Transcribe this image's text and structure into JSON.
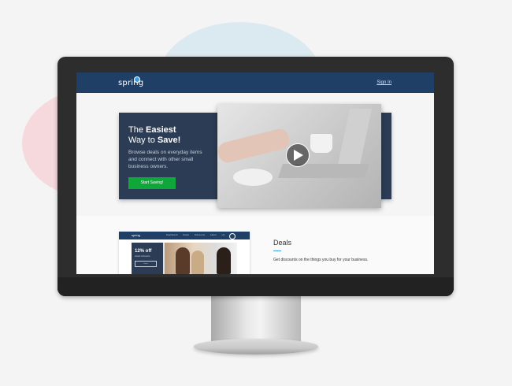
{
  "site": {
    "logo_text": "spring",
    "header_link": "Sign In"
  },
  "hero": {
    "title_prefix": "The ",
    "title_bold_1": "Easiest",
    "title_line2_prefix": "Way to ",
    "title_bold_2": "Save!",
    "subtitle": "Browse deals on everyday items and connect with other small business owners.",
    "cta_label": "Start Saving!"
  },
  "thumbnail": {
    "logo_text": "spring",
    "nav": "Dashboard Deals Discounts About Us",
    "offer_title": "12% off",
    "offer_sub": "Hotels & Resorts",
    "offer_btn": "Learn"
  },
  "deals": {
    "title": "Deals",
    "text": "Get discounts on the things you buy for your business."
  },
  "colors": {
    "header": "#1f3f66",
    "hero_card": "#2c3c54",
    "cta": "#0fa63a",
    "accent": "#3aa0e0"
  },
  "icons": {
    "play": "play-icon",
    "logo_mark": "spring-logo-dot"
  }
}
